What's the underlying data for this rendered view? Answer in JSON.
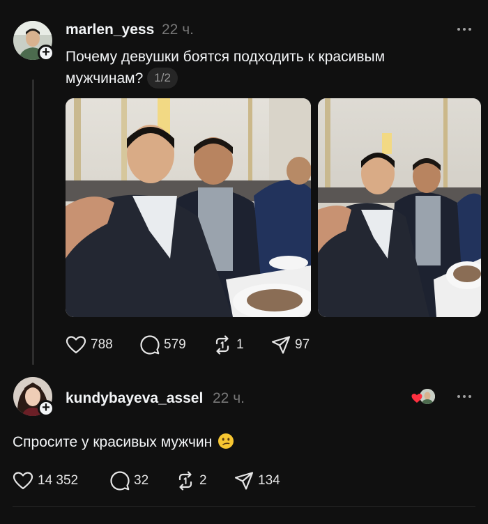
{
  "post": {
    "author": "marlen_yess",
    "time": "22 ч.",
    "text": "Почему девушки боятся подходить к красивым мужчинам?",
    "page_indicator": "1/2",
    "likes": "788",
    "comments": "579",
    "reposts": "1",
    "shares": "97"
  },
  "reply": {
    "author": "kundybayeva_assel",
    "time": "22 ч.",
    "text": "Спросите у красивых мужчин",
    "emoji": "confused-face",
    "likes": "14 352",
    "comments": "32",
    "reposts": "2",
    "shares": "134"
  },
  "colors": {
    "background": "#101010",
    "text": "#f3f5f7",
    "muted": "#777777",
    "like_heart": "#ff3040"
  }
}
